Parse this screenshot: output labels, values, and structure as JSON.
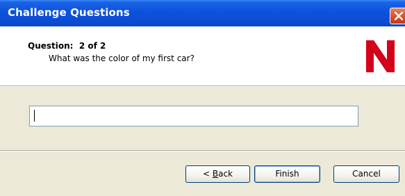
{
  "window": {
    "title": "Challenge Questions"
  },
  "question": {
    "label": "Question:  2 of 2",
    "text": "What was the color of my first car?"
  },
  "answer": {
    "value": "",
    "placeholder": ""
  },
  "buttons": {
    "back_prefix": "< ",
    "back_mnemonic": "B",
    "back_rest": "ack",
    "finish": "Finish",
    "cancel": "Cancel"
  },
  "branding": {
    "logo_icon": "novell-n-logo",
    "logo_color": "#d4001a"
  },
  "colors": {
    "titlebar": "#0a4cd6",
    "dialog_bg": "#ece9d8",
    "close_button": "#d9542e"
  }
}
